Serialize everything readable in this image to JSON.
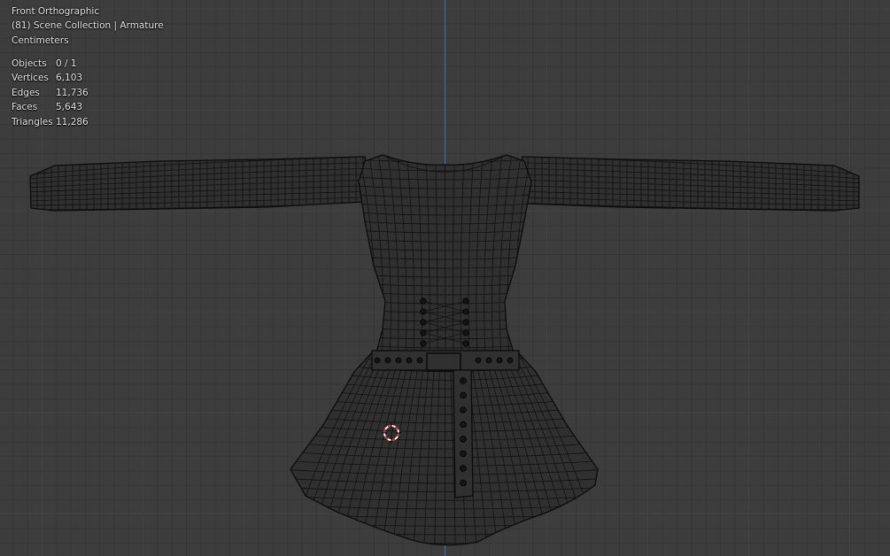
{
  "viewport": {
    "view_name": "Front Orthographic",
    "collection_info": "(81) Scene Collection | Armature",
    "units": "Centimeters",
    "stats": [
      {
        "label": "Objects",
        "value": "0 / 1"
      },
      {
        "label": "Vertices",
        "value": "6,103"
      },
      {
        "label": "Edges",
        "value": "11,736"
      },
      {
        "label": "Faces",
        "value": "5,643"
      },
      {
        "label": "Triangles",
        "value": "11,286"
      }
    ]
  },
  "colors": {
    "background": "#3d3d3d",
    "z_axis": "#3a6fb0",
    "wire": "#111111",
    "cursor_red": "#d22828"
  },
  "icons": [
    "3d-cursor-icon"
  ]
}
